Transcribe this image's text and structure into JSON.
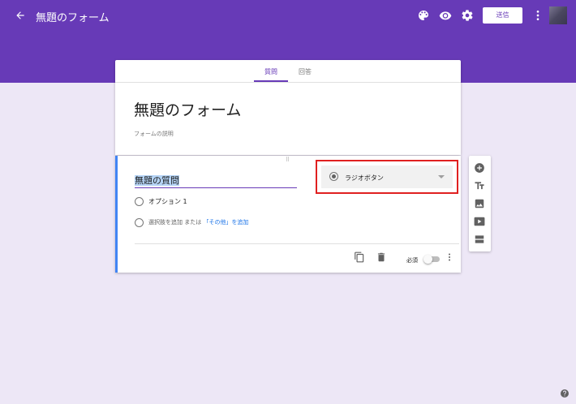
{
  "header": {
    "form_title": "無題のフォーム",
    "send_label": "送信"
  },
  "tabs": [
    {
      "label": "質問",
      "active": true
    },
    {
      "label": "回答",
      "active": false
    }
  ],
  "form": {
    "title": "無題のフォーム",
    "description_placeholder": "フォームの説明"
  },
  "question": {
    "title": "無題の質問",
    "type": "ラジオボタン",
    "options": [
      "オプション 1"
    ],
    "add_option_text": "選択肢を追加",
    "or_text": "または",
    "add_other_link": "「その他」を追加",
    "required_label": "必須",
    "required": false
  },
  "colors": {
    "brand": "#673ab7",
    "background": "#ede7f6",
    "active_border": "#4285f4",
    "highlight_box": "#e02020"
  },
  "icons": {
    "header": [
      "back-arrow-icon",
      "palette-icon",
      "eye-icon",
      "gear-icon",
      "more-vert-icon"
    ],
    "sidebar": [
      "add-circle-icon",
      "title-text-icon",
      "image-icon",
      "video-icon",
      "section-icon"
    ],
    "footer": [
      "copy-icon",
      "trash-icon",
      "more-vert-icon"
    ]
  }
}
